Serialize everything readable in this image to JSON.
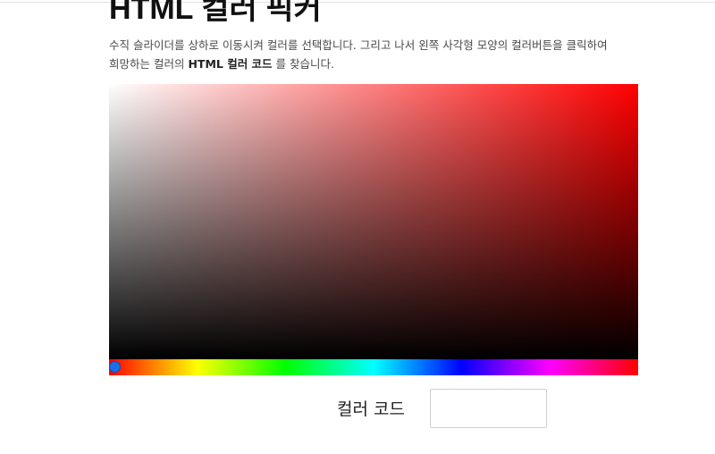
{
  "header": {
    "title": "HTML 컬러 픽커"
  },
  "description": {
    "line1": "수직 슬라이더를 상하로 이동시켜 컬러를 선택합니다. 그리고 나서 왼쪽 사각형 모양의 컬러버튼을 클릭하여",
    "line2_prefix": "희망하는 컬러의 ",
    "line2_bold": "HTML 컬러 코드",
    "line2_suffix": " 를 찾습니다."
  },
  "picker": {
    "base_hue_color": "#ff0000",
    "hue_value": 0
  },
  "hue_slider": {
    "handle_color": "#1a6fe8"
  },
  "color_code": {
    "label": "컬러 코드",
    "value": ""
  }
}
